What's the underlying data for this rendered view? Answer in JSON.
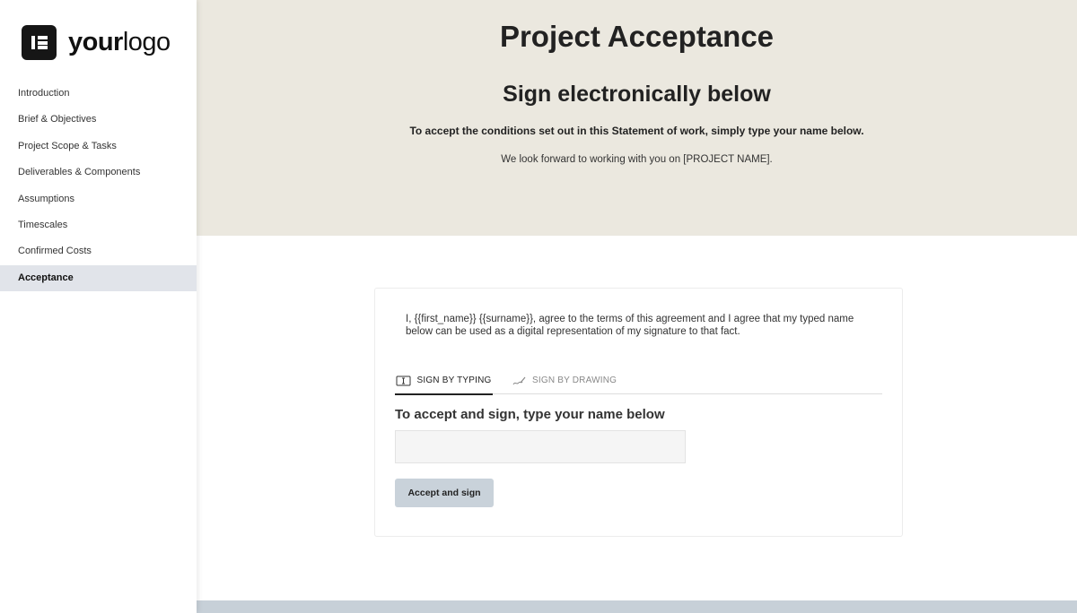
{
  "logo": {
    "text_bold": "your",
    "text_light": "logo"
  },
  "sidebar": {
    "items": [
      {
        "label": "Introduction",
        "active": false
      },
      {
        "label": "Brief & Objectives",
        "active": false
      },
      {
        "label": "Project Scope & Tasks",
        "active": false
      },
      {
        "label": "Deliverables & Components",
        "active": false
      },
      {
        "label": "Assumptions",
        "active": false
      },
      {
        "label": "Timescales",
        "active": false
      },
      {
        "label": "Confirmed Costs",
        "active": false
      },
      {
        "label": "Acceptance",
        "active": true
      }
    ]
  },
  "hero": {
    "title": "Project Acceptance",
    "subtitle": "Sign electronically below",
    "lead": "To accept the conditions set out in this Statement of work, simply type your name below.",
    "sub": "We look forward to working with you on [PROJECT NAME]."
  },
  "card": {
    "agreement": "I, {{first_name}} {{surname}}, agree to the terms of this agreement and I agree that my typed name below can be used as a digital representation of my signature to that fact.",
    "tabs": [
      {
        "label": "SIGN BY TYPING",
        "icon": "keyboard-icon",
        "active": true
      },
      {
        "label": "SIGN BY DRAWING",
        "icon": "pen-icon",
        "active": false
      }
    ],
    "sign_heading": "To accept and sign, type your name below",
    "name_value": "",
    "button_label": "Accept and sign"
  },
  "colors": {
    "hero_bg": "#ebe8df",
    "active_nav_bg": "#e1e4ea",
    "button_bg": "#c9d2da",
    "footer_strip": "#c7d0d8"
  }
}
